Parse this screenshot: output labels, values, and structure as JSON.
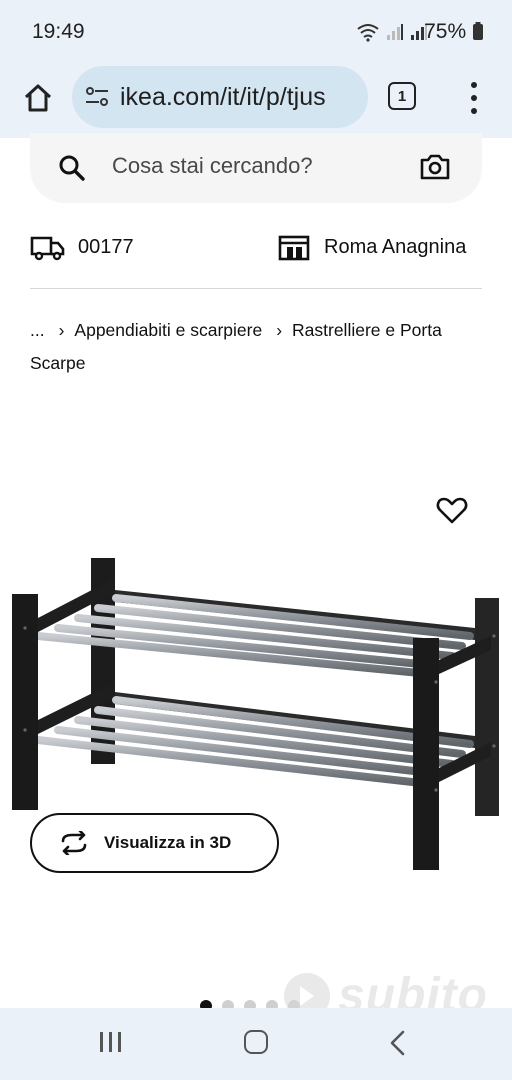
{
  "status": {
    "time": "19:49",
    "battery": "75%"
  },
  "browser": {
    "url": "ikea.com/it/it/p/tjus",
    "tab_count": "1"
  },
  "search": {
    "placeholder": "Cosa stai cercando?"
  },
  "location": {
    "zip": "00177",
    "store": "Roma Anagnina"
  },
  "breadcrumb": {
    "ellipsis": "...",
    "items": [
      "Appendiabiti e scarpiere",
      "Rastrelliere e Porta Scarpe"
    ]
  },
  "product": {
    "view3d_label": "Visualizza in 3D"
  },
  "carousel": {
    "count": 5,
    "active_index": 0
  },
  "watermark": {
    "text": "subito"
  },
  "colors": {
    "chrome": "#ebf1f8",
    "urlbar": "#d4e5f2",
    "search_bg": "#f5f5f5",
    "frame": "#1c1c1c",
    "rod": "#9aa0a6"
  }
}
